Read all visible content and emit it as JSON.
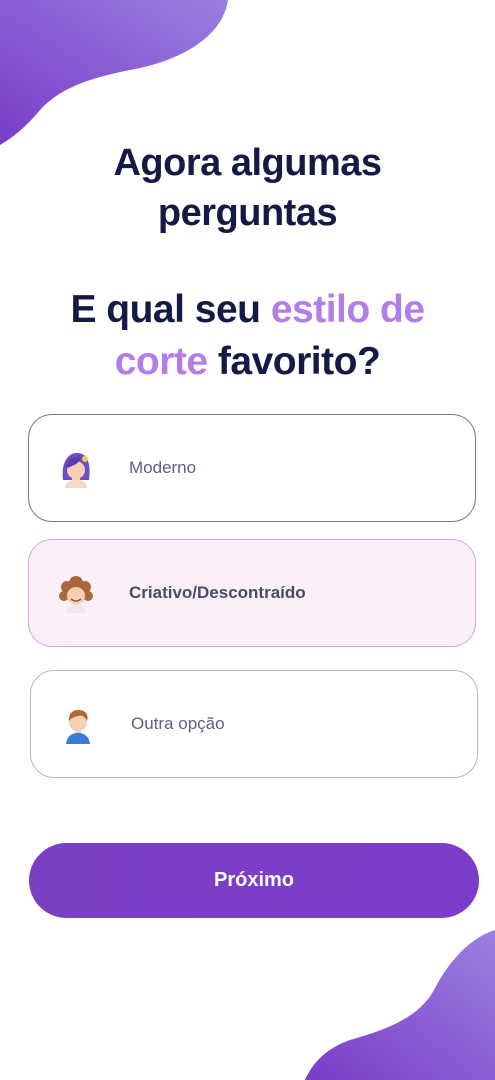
{
  "colors": {
    "accent": "#b37de8",
    "primary": "#7b3fc4",
    "heading": "#141a45",
    "selected_bg": "#fbf0f7"
  },
  "header": {
    "title_line1": "Agora algumas",
    "title_line2": "perguntas"
  },
  "question": {
    "part1": "E qual seu ",
    "accent1": "estilo de",
    "accent2": "corte",
    "part2": " favorito?"
  },
  "options": [
    {
      "label": "Moderno",
      "icon": "woman-avatar-icon"
    },
    {
      "label": "Criativo/Descontraído",
      "icon": "curly-hair-avatar-icon",
      "selected": true
    },
    {
      "label": "Outra opção",
      "icon": "man-avatar-icon"
    }
  ],
  "next_button": {
    "label": "Próximo"
  }
}
